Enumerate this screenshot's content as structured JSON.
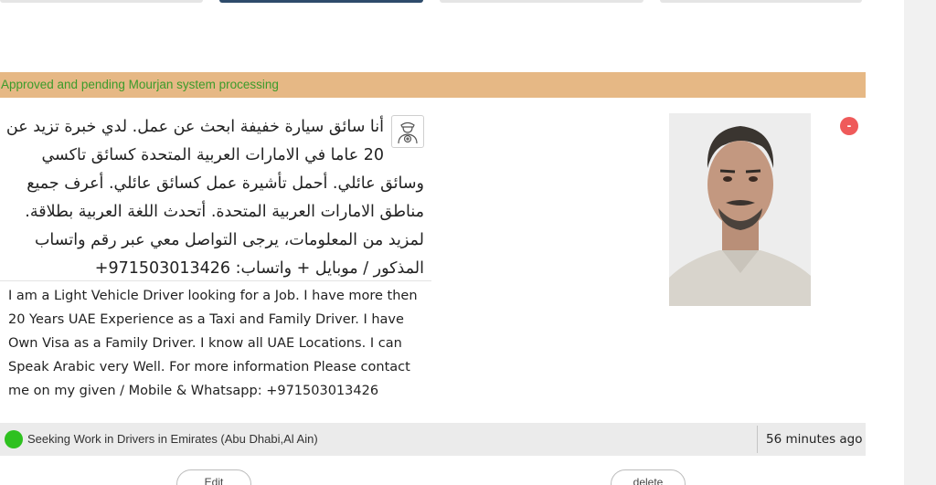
{
  "status_bar": {
    "text": "Approved and pending Mourjan system processing",
    "bg": "#e6b885",
    "text_color": "#3b9b2b"
  },
  "ad": {
    "arabic_text": "أنا سائق سيارة خفيفة ابحث عن عمل. لدي خبرة تزيد عن 20 عاما في الامارات العربية المتحدة كسائق تاكسي وسائق عائلي. أحمل تأشيرة عمل كسائق عائلي. أعرف جميع مناطق الامارات العربية المتحدة. أتحدث اللغة العربية بطلاقة. لمزيد من المعلومات، يرجى التواصل معي عبر رقم واتساب المذكور / موبايل + واتساب: 971503013426+",
    "english_text": "I am a Light Vehicle Driver looking for a Job. I have more then 20 Years UAE Experience as a Taxi and Family Driver. I have Own Visa as a Family Driver. I know all UAE Locations. I can Speak Arabic very Well. For more information Please contact me on my given / Mobile & Whatsapp: +971503013426",
    "category_icon": "driver-icon",
    "remove_label": "-"
  },
  "footer": {
    "seeking_text": "Seeking Work in Drivers in Emirates (Abu Dhabi,Al Ain)",
    "time_ago": "56 minutes ago",
    "status_color": "#2ec11f"
  },
  "actions": {
    "edit_label": "Edit",
    "delete_label": "delete"
  },
  "top_buttons": [
    {
      "label": ""
    },
    {
      "label": "",
      "active": true
    },
    {
      "label": ""
    },
    {
      "label": ""
    }
  ]
}
